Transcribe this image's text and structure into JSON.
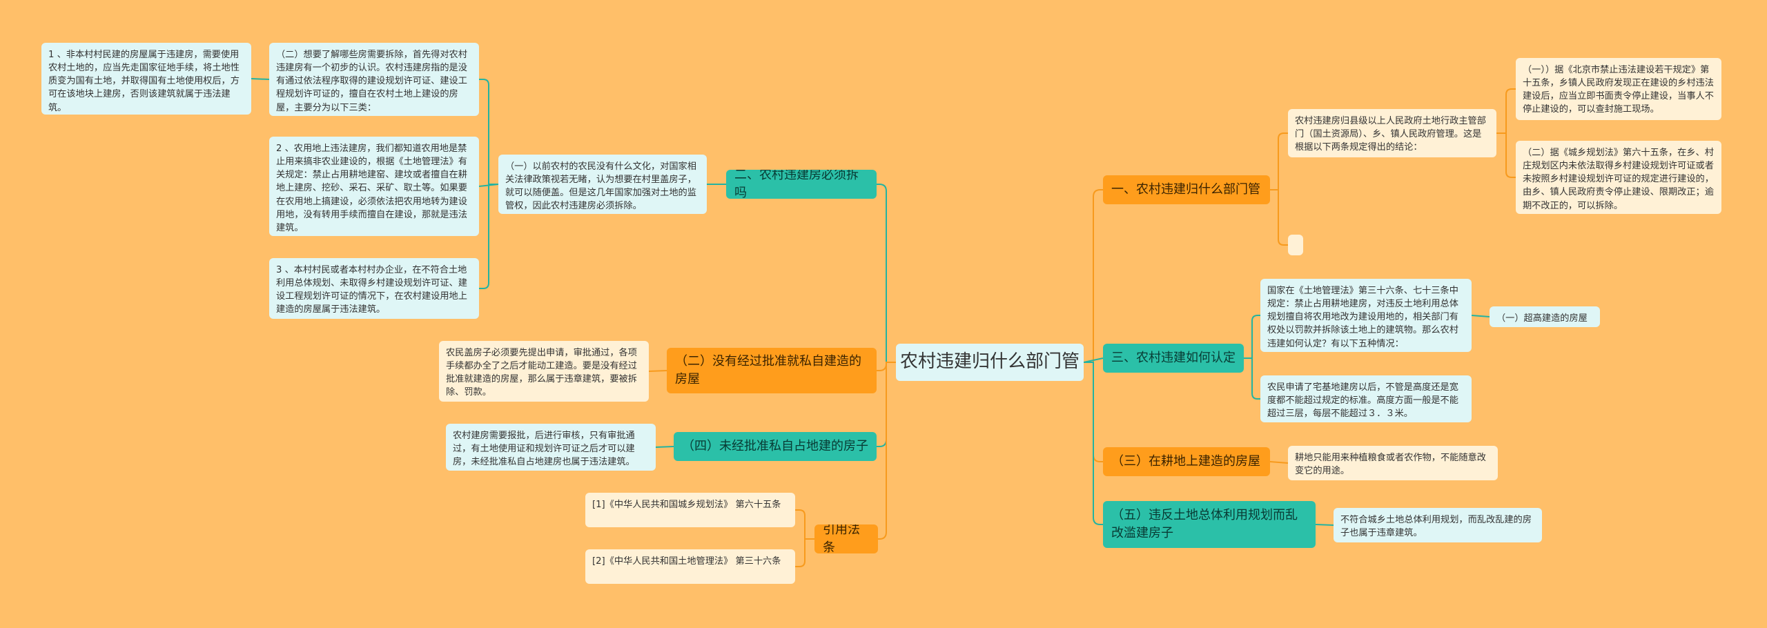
{
  "root": "农村违建归什么部门管",
  "right": {
    "b1": {
      "label": "一、农村违建归什么部门管",
      "intro": "农村违建房归县级以上人民政府土地行政主管部门（国土资源局）、乡、镇人民政府管理。这是根据以下两条规定得出的结论：",
      "leaf1": "（一））据《北京市禁止违法建设若干规定》第十五条，乡镇人民政府发现正在建设的乡村违法建设后，应当立即书面责令停止建设，当事人不停止建设的，可以查封施工现场。",
      "leaf2": "（二）据《城乡规划法》第六十五条，在乡、村庄规划区内未依法取得乡村建设规划许可证或者未按照乡村建设规划许可证的规定进行建设的，由乡、镇人民政府责令停止建设、限期改正；逾期不改正的，可以拆除。"
    },
    "b2": {
      "label": "三、农村违建如何认定",
      "leaf1": "国家在《土地管理法》第三十六条、七十三条中规定：禁止占用耕地建房，对违反土地利用总体规划擅自将农用地改为建设用地的，相关部门有权处以罚款并拆除该土地上的建筑物。那么农村违建如何认定？有以下五种情况：",
      "leaf1_child": "（一）超高建造的房屋",
      "leaf2": "农民申请了宅基地建房以后，不管是高度还是宽度都不能超过规定的标准。高度方面一般是不能超过三层，每层不能超过３．３米。"
    },
    "b3": {
      "label": "（三）在耕地上建造的房屋",
      "leaf": "耕地只能用来种植粮食或者农作物，不能随意改变它的用途。"
    },
    "b4": {
      "label": "（五）违反土地总体利用规划而乱改滥建房子",
      "leaf": "不符合城乡土地总体利用规划，而乱改乱建的房子也属于违章建筑。"
    }
  },
  "left": {
    "b1": {
      "label": "二、农村违建房必须拆吗",
      "leaf": "（一）以前农村的农民没有什么文化，对国家相关法律政策视若无睹，认为想要在村里盖房子，就可以随便盖。但是这几年国家加强对土地的监管权，因此农村违建房必须拆除。",
      "sub1": "（二）想要了解哪些房需要拆除，首先得对农村违建房有一个初步的认识。农村违建房指的是没有通过依法程序取得的建设规划许可证、建设工程规划许可证的，擅自在农村土地上建设的房屋，主要分为以下三类：",
      "sub1_child": "1 、非本村村民建的房屋属于违建房，需要使用农村土地的，应当先走国家征地手续，将土地性质变为国有土地，并取得国有土地使用权后，方可在该地块上建房，否则该建筑就属于违法建筑。",
      "sub2": "2 、农用地上违法建房，我们都知道农用地是禁止用来搞非农业建设的，根据《土地管理法》有关规定：禁止占用耕地建窑、建坟或者擅自在耕地上建房、挖砂、采石、采矿、取土等。如果要在农用地上搞建设，必须依法把农用地转为建设用地，没有转用手续而擅自在建设，那就是违法建筑。",
      "sub3": "3 、本村村民或者本村村办企业，在不符合土地利用总体规划、未取得乡村建设规划许可证、建设工程规划许可证的情况下，在农村建设用地上建造的房屋属于违法建筑。"
    },
    "b2": {
      "label": "（二）没有经过批准就私自建造的房屋",
      "leaf": "农民盖房子必须要先提出申请，审批通过，各项手续都办全了之后才能动工建造。要是没有经过批准就建造的房屋，那么属于违章建筑，要被拆除、罚款。"
    },
    "b3": {
      "label": "（四）未经批准私自占地建的房子",
      "leaf": "农村建房需要报批，后进行审核，只有审批通过，有土地使用证和规划许可证之后才可以建房，未经批准私自占地建房也属于违法建筑。"
    },
    "b4": {
      "label": "引用法条",
      "leaf1": "[1]《中华人民共和国城乡规划法》 第六十五条",
      "leaf2": "[2]《中华人民共和国土地管理法》 第三十六条"
    }
  },
  "colors": {
    "background": "#ffbf69",
    "orange_branch": "#ff9d1c",
    "teal_branch": "#2bc0a8",
    "cream_leaf": "#fff1d6",
    "teal_leaf": "#dff6f6",
    "orange_line": "#f79a1d",
    "teal_line": "#22b3a1"
  }
}
